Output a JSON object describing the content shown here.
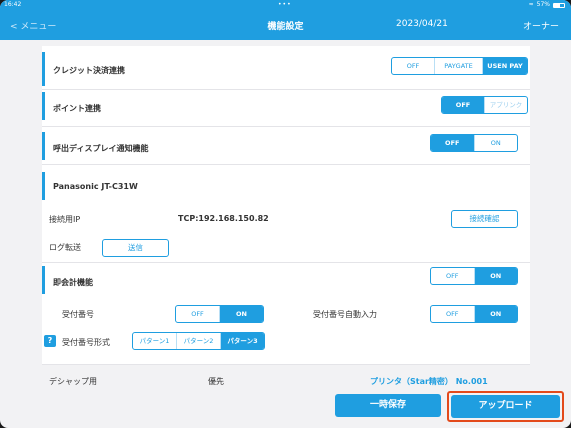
{
  "status_bar": {
    "time": "16:42",
    "dots": "•••",
    "wifi": "≈",
    "battery": "57%"
  },
  "nav": {
    "back": "< メニュー",
    "title": "機能設定",
    "date": "2023/04/21",
    "user": "オーナー"
  },
  "credit": {
    "label": "クレジット決済連携",
    "options": [
      "OFF",
      "PAYGATE",
      "USEN PAY"
    ],
    "selected": "USEN PAY"
  },
  "point": {
    "label": "ポイント連携",
    "options": [
      "OFF",
      "アプリンク"
    ],
    "selected": "OFF"
  },
  "call_display": {
    "label": "呼出ディスプレイ通知機能",
    "options": [
      "OFF",
      "ON"
    ],
    "selected": "OFF"
  },
  "device": {
    "label": "Panasonic JT-C31W",
    "ip_label": "接続用IP",
    "ip_value": "TCP:192.168.150.82",
    "check_button": "接続確認",
    "log_label": "ログ転送",
    "send_button": "送信"
  },
  "instant": {
    "label": "即会計機能",
    "options": [
      "OFF",
      "ON"
    ],
    "selected": "ON",
    "receipt_label": "受付番号",
    "receipt_options": [
      "OFF",
      "ON"
    ],
    "receipt_selected": "ON",
    "auto_label": "受付番号自動入力",
    "auto_options": [
      "OFF",
      "ON"
    ],
    "auto_selected": "ON",
    "help": "?",
    "format_label": "受付番号形式",
    "format_options": [
      "パターン1",
      "パターン2",
      "パターン3"
    ],
    "format_selected": "パターン3"
  },
  "dishup": {
    "label": "デシャップ用",
    "priority": "優先",
    "printer": "プリンタ（Star精密） No.001"
  },
  "actions": {
    "save": "一時保存",
    "upload": "アップロード"
  },
  "colors": {
    "accent": "#1f9ee0",
    "highlight": "#e34a1b"
  }
}
